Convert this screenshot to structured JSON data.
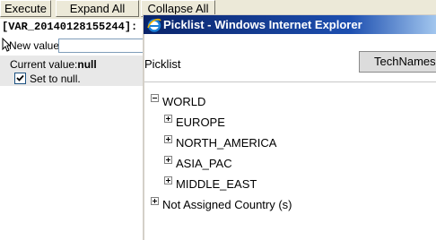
{
  "toolbar": {
    "execute_label": "Execute",
    "expand_all_label": "Expand All",
    "collapse_all_label": "Collapse All"
  },
  "variable": {
    "header": "[VAR_20140128155244]:",
    "new_value_label": "New value:",
    "new_value": "",
    "current_value_label": "Current value:",
    "current_value": "null",
    "set_to_null_label": "Set to null.",
    "set_to_null_checked": true
  },
  "popup": {
    "title": "Picklist - Windows Internet Explorer",
    "picklist_label": "Picklist",
    "technames_label": "TechNames"
  },
  "tree": [
    {
      "label": "WORLD",
      "toggle": "minus",
      "level": 0
    },
    {
      "label": "EUROPE",
      "toggle": "plus",
      "level": 1
    },
    {
      "label": "NORTH_AMERICA",
      "toggle": "plus",
      "level": 1
    },
    {
      "label": "ASIA_PAC",
      "toggle": "plus",
      "level": 1
    },
    {
      "label": "MIDDLE_EAST",
      "toggle": "plus",
      "level": 1
    },
    {
      "label": "Not Assigned Country (s)",
      "toggle": "plus",
      "level": 0
    }
  ]
}
